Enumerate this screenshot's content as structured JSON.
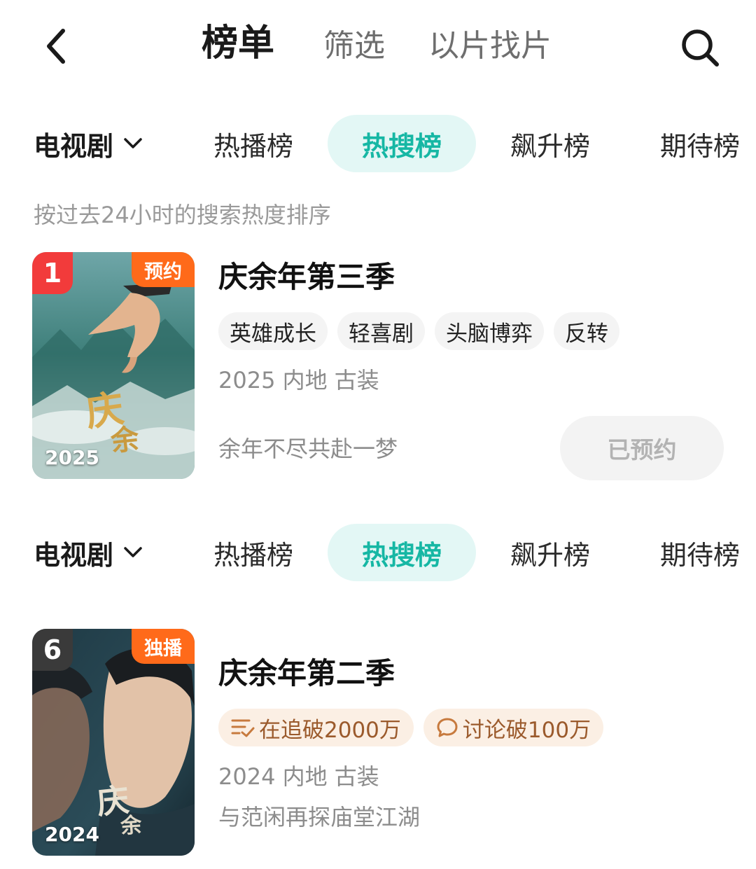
{
  "header": {
    "back_icon": "chevron-left-icon",
    "tabs": [
      {
        "label": "榜单",
        "active": true
      },
      {
        "label": "筛选",
        "active": false
      },
      {
        "label": "以片找片",
        "active": false
      }
    ],
    "search_icon": "search-icon"
  },
  "category_rows": [
    {
      "selector": {
        "label": "电视剧",
        "icon": "chevron-down-icon"
      },
      "tabs": [
        {
          "label": "热播榜",
          "active": false
        },
        {
          "label": "热搜榜",
          "active": true
        },
        {
          "label": "飙升榜",
          "active": false
        },
        {
          "label": "期待榜",
          "active": false
        }
      ]
    },
    {
      "selector": {
        "label": "电视剧",
        "icon": "chevron-down-icon"
      },
      "tabs": [
        {
          "label": "热播榜",
          "active": false
        },
        {
          "label": "热搜榜",
          "active": true
        },
        {
          "label": "飙升榜",
          "active": false
        },
        {
          "label": "期待榜",
          "active": false
        }
      ]
    }
  ],
  "description": "按过去24小时的搜索热度排序",
  "items": [
    {
      "rank": "1",
      "badge": "预约",
      "poster_year": "2025",
      "title": "庆余年第三季",
      "tags": [
        "英雄成长",
        "轻喜剧",
        "头脑博弈",
        "反转"
      ],
      "meta": "2025 内地 古装",
      "slogan": "余年不尽共赴一梦",
      "action_label": "已预约"
    },
    {
      "rank": "6",
      "badge": "独播",
      "poster_year": "2024",
      "title": "庆余年第二季",
      "stats": [
        {
          "icon": "list-check-icon",
          "label": "在追破2000万"
        },
        {
          "icon": "chat-bubble-icon",
          "label": "讨论破100万"
        }
      ],
      "meta": "2024 内地 古装",
      "slogan": "与范闲再探庙堂江湖"
    }
  ],
  "colors": {
    "accent": "#16b7a4",
    "accent_bg": "#e3f7f5",
    "rank1_badge": "#f23b3b",
    "rank_other_badge": "#3a3a3a",
    "status_badge": "#ff6a1a",
    "stat_tag_bg": "#fbefe4",
    "stat_tag_text": "#9b5a2c"
  }
}
